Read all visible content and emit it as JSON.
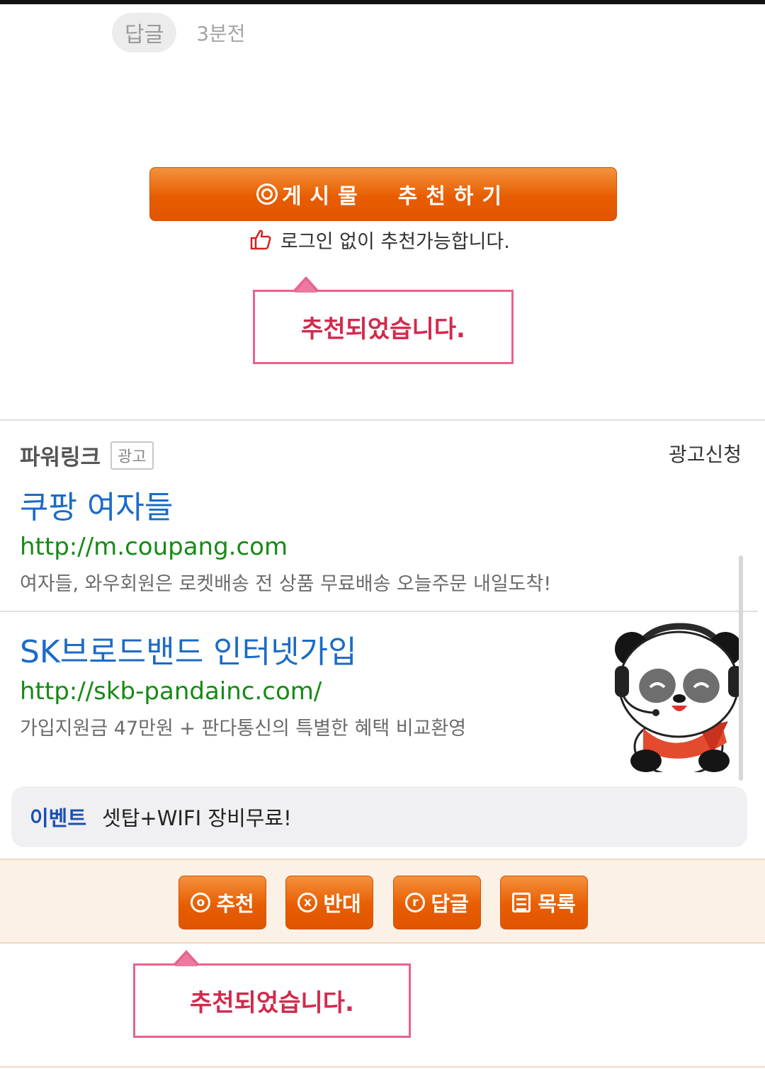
{
  "reply_row": {
    "chip_label": "답글",
    "time": "3분전"
  },
  "recommend": {
    "button_label": "게시물  추천하기",
    "login_note": "로그인 없이 추천가능합니다.",
    "toast": "추천되었습니다."
  },
  "powerlink": {
    "title": "파워링크",
    "badge": "광고",
    "apply_link": "광고신청",
    "ads": [
      {
        "headline": "쿠팡 여자들",
        "url": "http://m.coupang.com",
        "description": "여자들, 와우회원은 로켓배송 전 상품 무료배송 오늘주문 내일도착!"
      },
      {
        "headline": "SK브로드밴드 인터넷가입",
        "url": "http://skb-pandainc.com/",
        "description": "가입지원금 47만원 + 판다통신의 특별한 혜택 비교환영"
      }
    ],
    "event": {
      "label": "이벤트",
      "text": "셋탑+WIFI 장비무료!"
    }
  },
  "actions": {
    "recommend": "추천",
    "oppose": "반대",
    "reply": "답글",
    "list": "목록",
    "toast": "추천되었습니다."
  },
  "colors": {
    "accent_orange": "#e85d00",
    "toast_border": "#e8638a",
    "toast_text": "#d22a4d",
    "ad_link": "#1b6bc6",
    "ad_url": "#158a15"
  },
  "icons": [
    "circle-o-icon",
    "thumbs-up-icon",
    "circle-x-icon",
    "circle-r-icon",
    "list-icon",
    "panda-character-image"
  ]
}
